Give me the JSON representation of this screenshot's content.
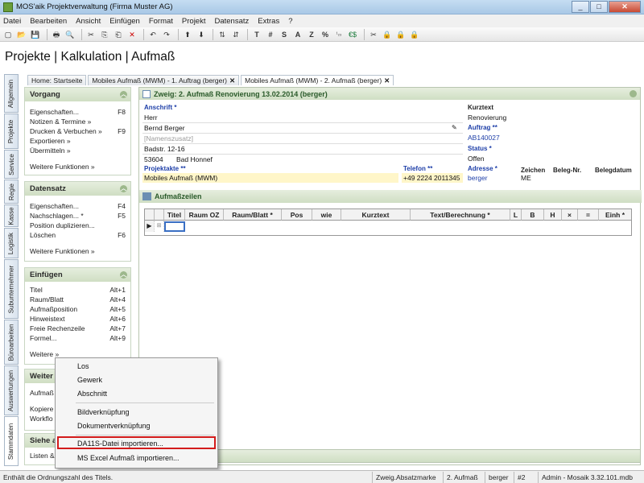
{
  "window": {
    "title": "MOS'aik Projektverwaltung (Firma Muster AG)",
    "min": "_",
    "max": "□",
    "close": "✕"
  },
  "menu": [
    "Datei",
    "Bearbeiten",
    "Ansicht",
    "Einfügen",
    "Format",
    "Projekt",
    "Datensatz",
    "Extras",
    "?"
  ],
  "toolbar_glyphs": [
    "▢",
    "📂",
    "💾",
    "🖶",
    "🔍",
    "✂",
    "⎘",
    "⎗",
    "✕",
    "↶",
    "↷",
    "⬆",
    "⬇",
    "⇅",
    "⇵",
    "T",
    "#",
    "S",
    "A",
    "Z",
    "%",
    "¹₂₃",
    "€$",
    "✂",
    "🔒",
    "🔒",
    "🔒"
  ],
  "heading": "Projekte | Kalkulation | Aufmaß",
  "vtabs": [
    "Allgemein",
    "Projekte",
    "Service",
    "Regie",
    "Kasse",
    "Logistik",
    "Subunternehmer",
    "Büroarbeiten",
    "Auswertungen",
    "Stammdaten"
  ],
  "tabs": [
    {
      "label": "Home: Startseite"
    },
    {
      "label": "Mobiles Aufmaß (MWM) - 1. Auftrag (berger)",
      "close": "✕"
    },
    {
      "label": "Mobiles Aufmaß (MWM) - 2. Aufmaß (berger)",
      "close": "✕"
    }
  ],
  "sidebar": {
    "vorgang": {
      "title": "Vorgang",
      "items": [
        {
          "label": "Eigenschaften...",
          "key": "F8"
        },
        {
          "label": "Notizen & Termine »",
          "key": ""
        },
        {
          "label": "Drucken & Verbuchen »",
          "key": "F9"
        },
        {
          "label": "Exportieren »",
          "key": ""
        },
        {
          "label": "Übermitteln »",
          "key": ""
        }
      ],
      "more": "Weitere Funktionen »"
    },
    "datensatz": {
      "title": "Datensatz",
      "items": [
        {
          "label": "Eigenschaften...",
          "key": "F4"
        },
        {
          "label": "Nachschlagen... *",
          "key": "F5"
        },
        {
          "label": "Position duplizieren...",
          "key": ""
        },
        {
          "label": "Löschen",
          "key": "F6"
        }
      ],
      "more": "Weitere Funktionen »"
    },
    "einfuegen": {
      "title": "Einfügen",
      "items": [
        {
          "label": "Titel",
          "key": "Alt+1"
        },
        {
          "label": "Raum/Blatt",
          "key": "Alt+4"
        },
        {
          "label": "Aufmaßposition",
          "key": "Alt+5"
        },
        {
          "label": "Hinweistext",
          "key": "Alt+6"
        },
        {
          "label": "Freie Rechenzeile",
          "key": "Alt+7"
        },
        {
          "label": "Formel...",
          "key": "Alt+9"
        }
      ],
      "more": "Weitere »"
    },
    "weitere": {
      "title": "Weiter",
      "items": [
        "Aufmaß",
        "Kopiere",
        "Workflo"
      ]
    },
    "siehe": {
      "title": "Siehe a",
      "items": [
        "Listen &"
      ]
    }
  },
  "zweig": {
    "title": "Zweig: 2. Aufmaß Renovierung 13.02.2014 (berger)"
  },
  "form": {
    "anschrift_label": "Anschrift *",
    "anrede": "Herr",
    "name": "Bernd Berger",
    "namenszusatz": "[Namenszusatz]",
    "strasse": "Badstr. 12-16",
    "plz": "53604",
    "ort": "Bad Honnef",
    "kurztext_label": "Kurztext",
    "kurztext": "Renovierung",
    "auftrag_label": "Auftrag **",
    "auftrag": "AB140027",
    "status_label": "Status *",
    "status": "Offen",
    "projektakte_label": "Projektakte **",
    "projektakte": "Mobiles Aufmaß (MWM)",
    "telefon_label": "Telefon **",
    "telefon": "+49 2224 2011345",
    "adresse_label": "Adresse *",
    "adresse": "berger",
    "zeichen_label": "Zeichen",
    "zeichen": "ME",
    "belegnr_label": "Beleg-Nr.",
    "belegdatum_label": "Belegdatum"
  },
  "aufmasszeilen": {
    "title": "Aufmaßzeilen",
    "columns": [
      "Titel",
      "Raum OZ",
      "Raum/Blatt *",
      "Pos",
      "wie",
      "Kurztext",
      "Text/Berechnung *",
      "L",
      "B",
      "H",
      "×",
      "=",
      "Einh *"
    ]
  },
  "context_menu": {
    "items": [
      "Los",
      "Gewerk",
      "Abschnitt",
      "Bildverknüpfung",
      "Dokumentverknüpfung",
      "DA11S-Datei importieren...",
      "MS Excel Aufmaß importieren..."
    ],
    "highlighted": "DA11S-Datei importieren...",
    "accent": "#d31b1b"
  },
  "status": {
    "message": "Enthält die Ordnungszahl des Titels.",
    "cells": [
      "Zweig.Absatzmarke",
      "2. Aufmaß",
      "berger",
      "#2",
      "Admin - Mosaik 3.32.101.mdb"
    ]
  }
}
